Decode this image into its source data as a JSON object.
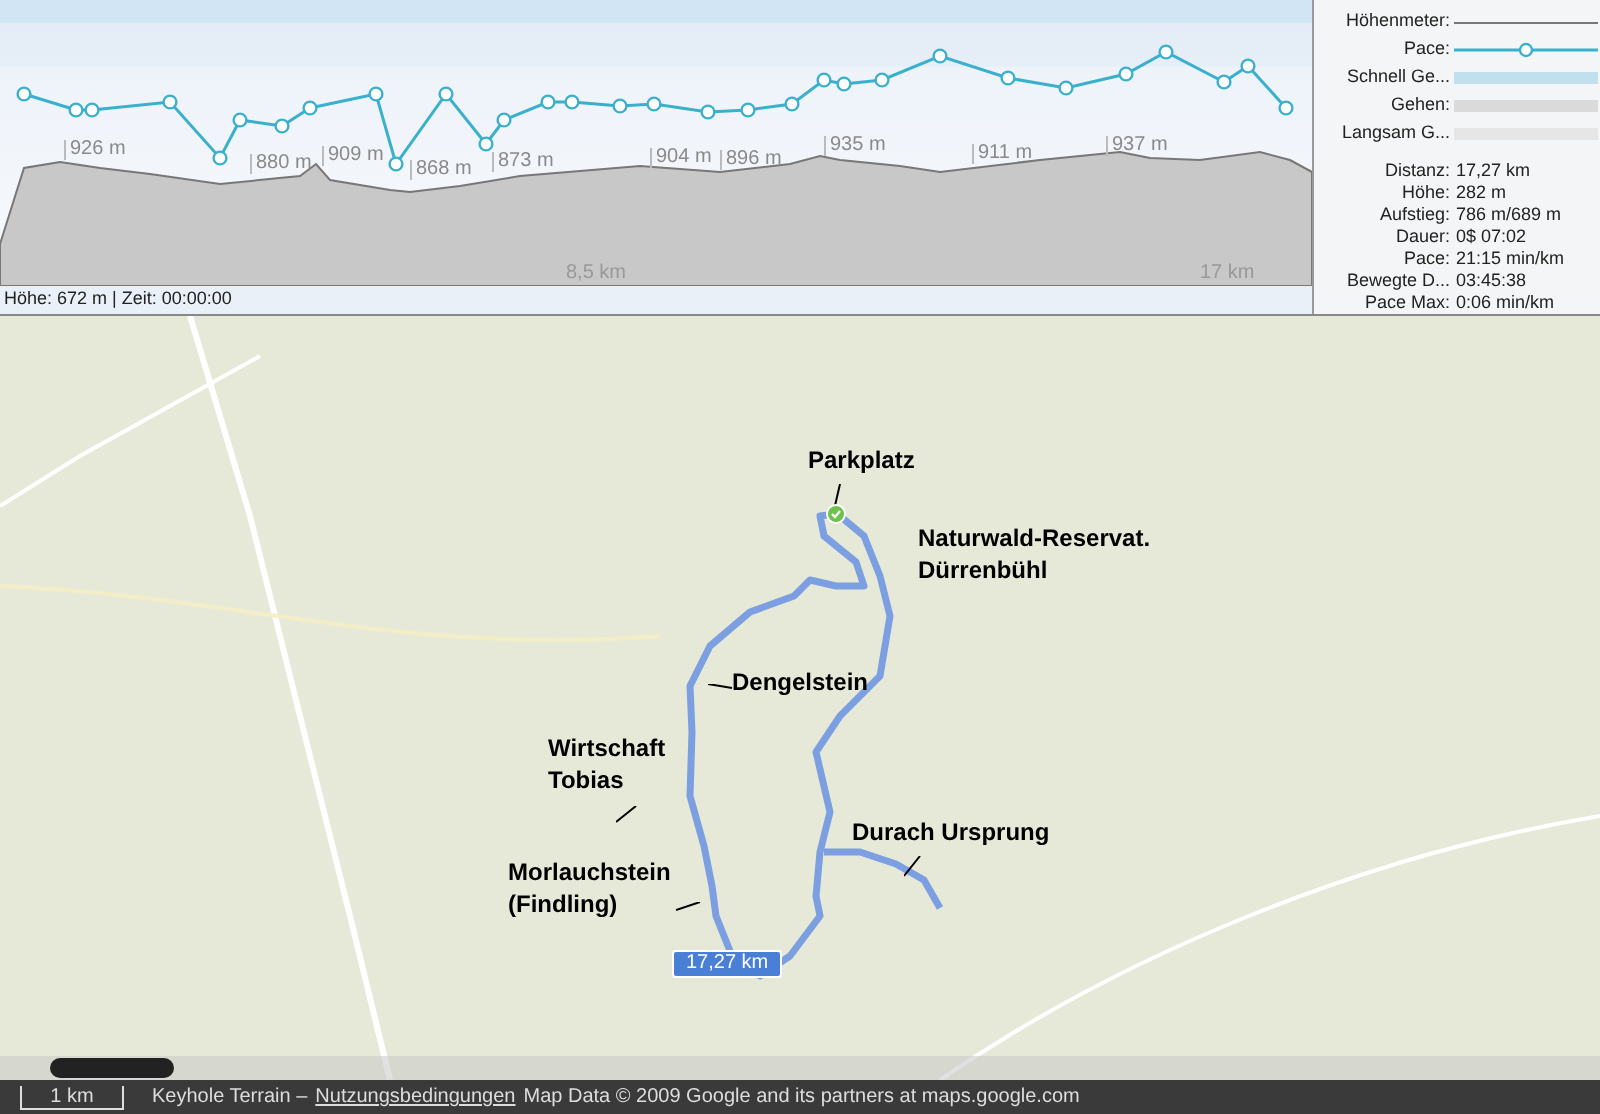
{
  "profile": {
    "peaks": [
      {
        "label": "926 m"
      },
      {
        "label": "880 m"
      },
      {
        "label": "909 m"
      },
      {
        "label": "868 m"
      },
      {
        "label": "873 m"
      },
      {
        "label": "904 m"
      },
      {
        "label": "896 m"
      },
      {
        "label": "935 m"
      },
      {
        "label": "911 m"
      },
      {
        "label": "937 m"
      }
    ],
    "distance_marks": [
      "8,5 km",
      "17 km"
    ],
    "status": "Höhe: 672 m | Zeit: 00:00:00"
  },
  "legend": [
    {
      "label": "Höhenmeter:",
      "kind": "line"
    },
    {
      "label": "Pace:",
      "kind": "pace"
    },
    {
      "label": "Schnell Ge...",
      "kind": "band",
      "color": "#bfe0ec"
    },
    {
      "label": "Gehen:",
      "kind": "band",
      "color": "#dadada"
    },
    {
      "label": "Langsam G...",
      "kind": "band",
      "color": "#e6e6e6"
    }
  ],
  "stats": [
    {
      "label": "Distanz:",
      "value": "17,27 km"
    },
    {
      "label": "Höhe:",
      "value": "282 m"
    },
    {
      "label": "Aufstieg:",
      "value": "786 m/689 m"
    },
    {
      "label": "Dauer:",
      "value": "0$ 07:02"
    },
    {
      "label": "Pace:",
      "value": "21:15 min/km"
    },
    {
      "label": "Bewegte D...",
      "value": "03:45:38"
    },
    {
      "label": "Pace Max:",
      "value": "0:06 min/km"
    }
  ],
  "map": {
    "labels": [
      {
        "lines": [
          "Parkplatz"
        ]
      },
      {
        "lines": [
          "Naturwald-Reservat.",
          "Dürrenbühl"
        ]
      },
      {
        "lines": [
          "Dengelstein"
        ]
      },
      {
        "lines": [
          "Wirtschaft",
          "Tobias"
        ]
      },
      {
        "lines": [
          "Durach Ursprung"
        ]
      },
      {
        "lines": [
          "Morlauchstein",
          "(Findling)"
        ]
      }
    ],
    "route_badge": "17,27 km"
  },
  "footer": {
    "scale": "1 km",
    "source": "Keyhole Terrain –",
    "link": "Nutzungsbedingungen",
    "credit": "Map Data © 2009 Google and its partners at maps.google.com"
  }
}
